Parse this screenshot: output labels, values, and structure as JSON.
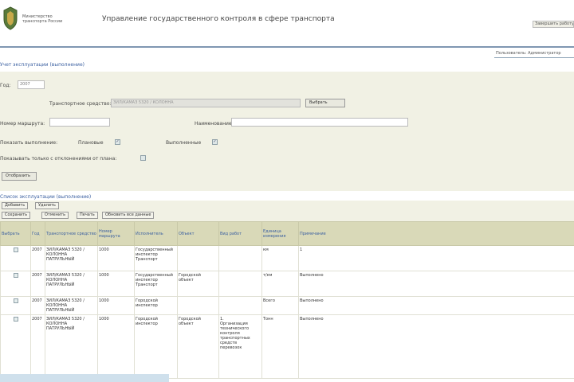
{
  "header": {
    "org_name": "Министерство\nтранспорта России",
    "app_title": "Управление государственного контроля в сфере транспорта",
    "top_button": "Завершить работу",
    "subtext": "Пользователь: Администратор"
  },
  "breadcrumb": "Учет эксплуатации (выполнение)",
  "filters": {
    "year_label": "Год:",
    "year_value": "2007",
    "vehicle_label": "Транспортное средство:",
    "vehicle_value": "ЗИЛ/КАМАЗ 5320 / КОЛОННА",
    "select_button": "Выбрать",
    "route_label": "Номер маршрута:",
    "route_value": "",
    "name_label": "Наименование:",
    "name_value": "",
    "show_label": "Показать выполнение:",
    "planned_label": "Плановые",
    "executed_label": "Выполненные",
    "only_label": "Показывать только с отклонениями от плана:",
    "apply_button": "Отобразить",
    "check_mark": "✓"
  },
  "list": {
    "title": "Список эксплуатации (выполнение)",
    "toolbar_row1": [
      "Добавить",
      "Удалить"
    ],
    "toolbar_row2": [
      "Сохранить",
      "Отменить",
      "Печать",
      "Обновить все данные"
    ]
  },
  "table": {
    "columns": [
      "Выбрать",
      "Год",
      "Транспортное средство",
      "Номер маршрута",
      "Исполнитель",
      "Объект",
      "Вид работ",
      "Единица измерения",
      "Примечание"
    ],
    "rows": [
      {
        "year": "2007",
        "vehicle": "ЗИЛ/КАМАЗ 5320 / КОЛОННА\nПАТРУЛЬНЫЙ",
        "route": "1000",
        "executor": "Государственный\nинспектор\nТранспорт",
        "object": "",
        "work": "",
        "unit": "км",
        "note": "1"
      },
      {
        "year": "2007",
        "vehicle": "ЗИЛ/КАМАЗ 5320 / КОЛОННА\nПАТРУЛЬНЫЙ",
        "route": "1000",
        "executor": "Государственный\nинспектор\nТранспорт",
        "object": "Городской\nобъект",
        "work": "",
        "unit": "т/км",
        "note": "Выполнено"
      },
      {
        "year": "2007",
        "vehicle": "ЗИЛ/КАМАЗ 5320 / КОЛОННА\nПАТРУЛЬНЫЙ",
        "route": "1000",
        "executor": "Городской\nинспектор",
        "object": "",
        "work": "",
        "unit": "Всего",
        "note": "Выполнено"
      },
      {
        "year": "2007",
        "vehicle": "ЗИЛ/КАМАЗ 5320 / КОЛОННА\nПАТРУЛЬНЫЙ",
        "route": "1000",
        "executor": "Городской\nинспектор",
        "object": "Городской\nобъект",
        "work": "1.\nОрганизация\nтехнического\nконтроля\nтранспортных\nсредств\nперевозок",
        "unit": "Тонн",
        "note": "Выполнено"
      }
    ]
  }
}
